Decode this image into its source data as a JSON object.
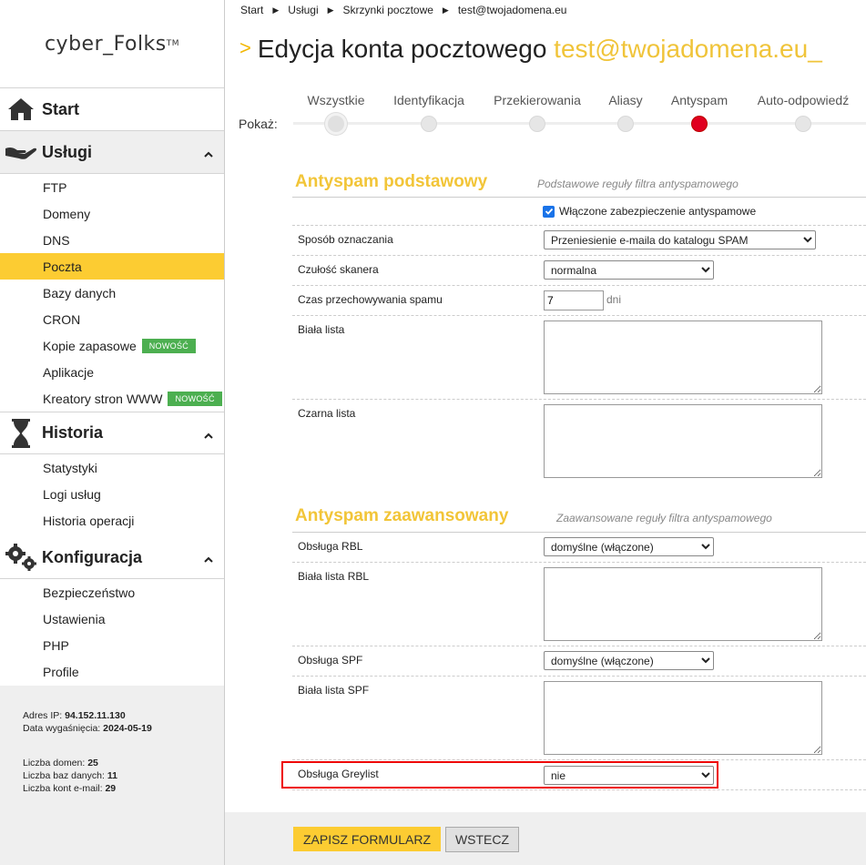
{
  "brand": {
    "name": "cyber_Folks",
    "tm": "TM"
  },
  "sidebar": {
    "start": {
      "label": "Start",
      "icon": "home-icon"
    },
    "uslugi": {
      "label": "Usługi",
      "icon": "hand-icon",
      "items": [
        "FTP",
        "Domeny",
        "DNS",
        "Poczta",
        "Bazy danych",
        "CRON",
        "Kopie zapasowe",
        "Aplikacje",
        "Kreatory stron WWW"
      ],
      "badge": "NOWOŚĆ",
      "active": "Poczta"
    },
    "historia": {
      "label": "Historia",
      "icon": "hourglass-icon",
      "items": [
        "Statystyki",
        "Logi usług",
        "Historia operacji"
      ]
    },
    "konfiguracja": {
      "label": "Konfiguracja",
      "icon": "gears-icon",
      "items": [
        "Bezpieczeństwo",
        "Ustawienia",
        "PHP",
        "Profile"
      ]
    },
    "info": {
      "ip_label": "Adres IP:",
      "ip": "94.152.11.130",
      "exp_label": "Data wygaśnięcia:",
      "exp": "2024-05-19",
      "domains_label": "Liczba domen:",
      "domains": "25",
      "dbs_label": "Liczba baz danych:",
      "dbs": "11",
      "emails_label": "Liczba kont e-mail:",
      "emails": "29"
    }
  },
  "breadcrumb": [
    "Start",
    "Usługi",
    "Skrzynki pocztowe",
    "test@twojadomena.eu"
  ],
  "title": {
    "chevron": ">",
    "text": "Edycja konta pocztowego",
    "email": "test@twojadomena.eu_"
  },
  "tabs": {
    "show_label": "Pokaż:",
    "items": [
      "Wszystkie",
      "Identyfikacja",
      "Przekierowania",
      "Aliasy",
      "Antyspam",
      "Auto-odpowiedź"
    ],
    "active": "Antyspam"
  },
  "basic": {
    "title": "Antyspam podstawowy",
    "subtitle": "Podstawowe reguły filtra antyspamowego",
    "enabled_label": "Włączone zabezpieczenie antyspamowe",
    "marking_label": "Sposób oznaczania",
    "marking_value": "Przeniesienie e-maila do katalogu SPAM",
    "sensitivity_label": "Czułość skanera",
    "sensitivity_value": "normalna",
    "retention_label": "Czas przechowywania spamu",
    "retention_value": "7",
    "retention_unit": "dni",
    "whitelist_label": "Biała lista",
    "blacklist_label": "Czarna lista"
  },
  "advanced": {
    "title": "Antyspam zaawansowany",
    "subtitle": "Zaawansowane reguły filtra antyspamowego",
    "rbl_label": "Obsługa RBL",
    "rbl_value": "domyślne (włączone)",
    "rbl_whitelist_label": "Biała lista RBL",
    "spf_label": "Obsługa SPF",
    "spf_value": "domyślne (włączone)",
    "spf_whitelist_label": "Biała lista SPF",
    "greylist_label": "Obsługa Greylist",
    "greylist_value": "nie"
  },
  "buttons": {
    "save": "ZAPISZ FORMULARZ",
    "back": "WSTECZ"
  },
  "colors": {
    "accent": "#fccc32",
    "title_accent": "#f2c538",
    "active_dot": "#e00020",
    "badge": "#4caf50",
    "highlight": "#ee0000"
  }
}
